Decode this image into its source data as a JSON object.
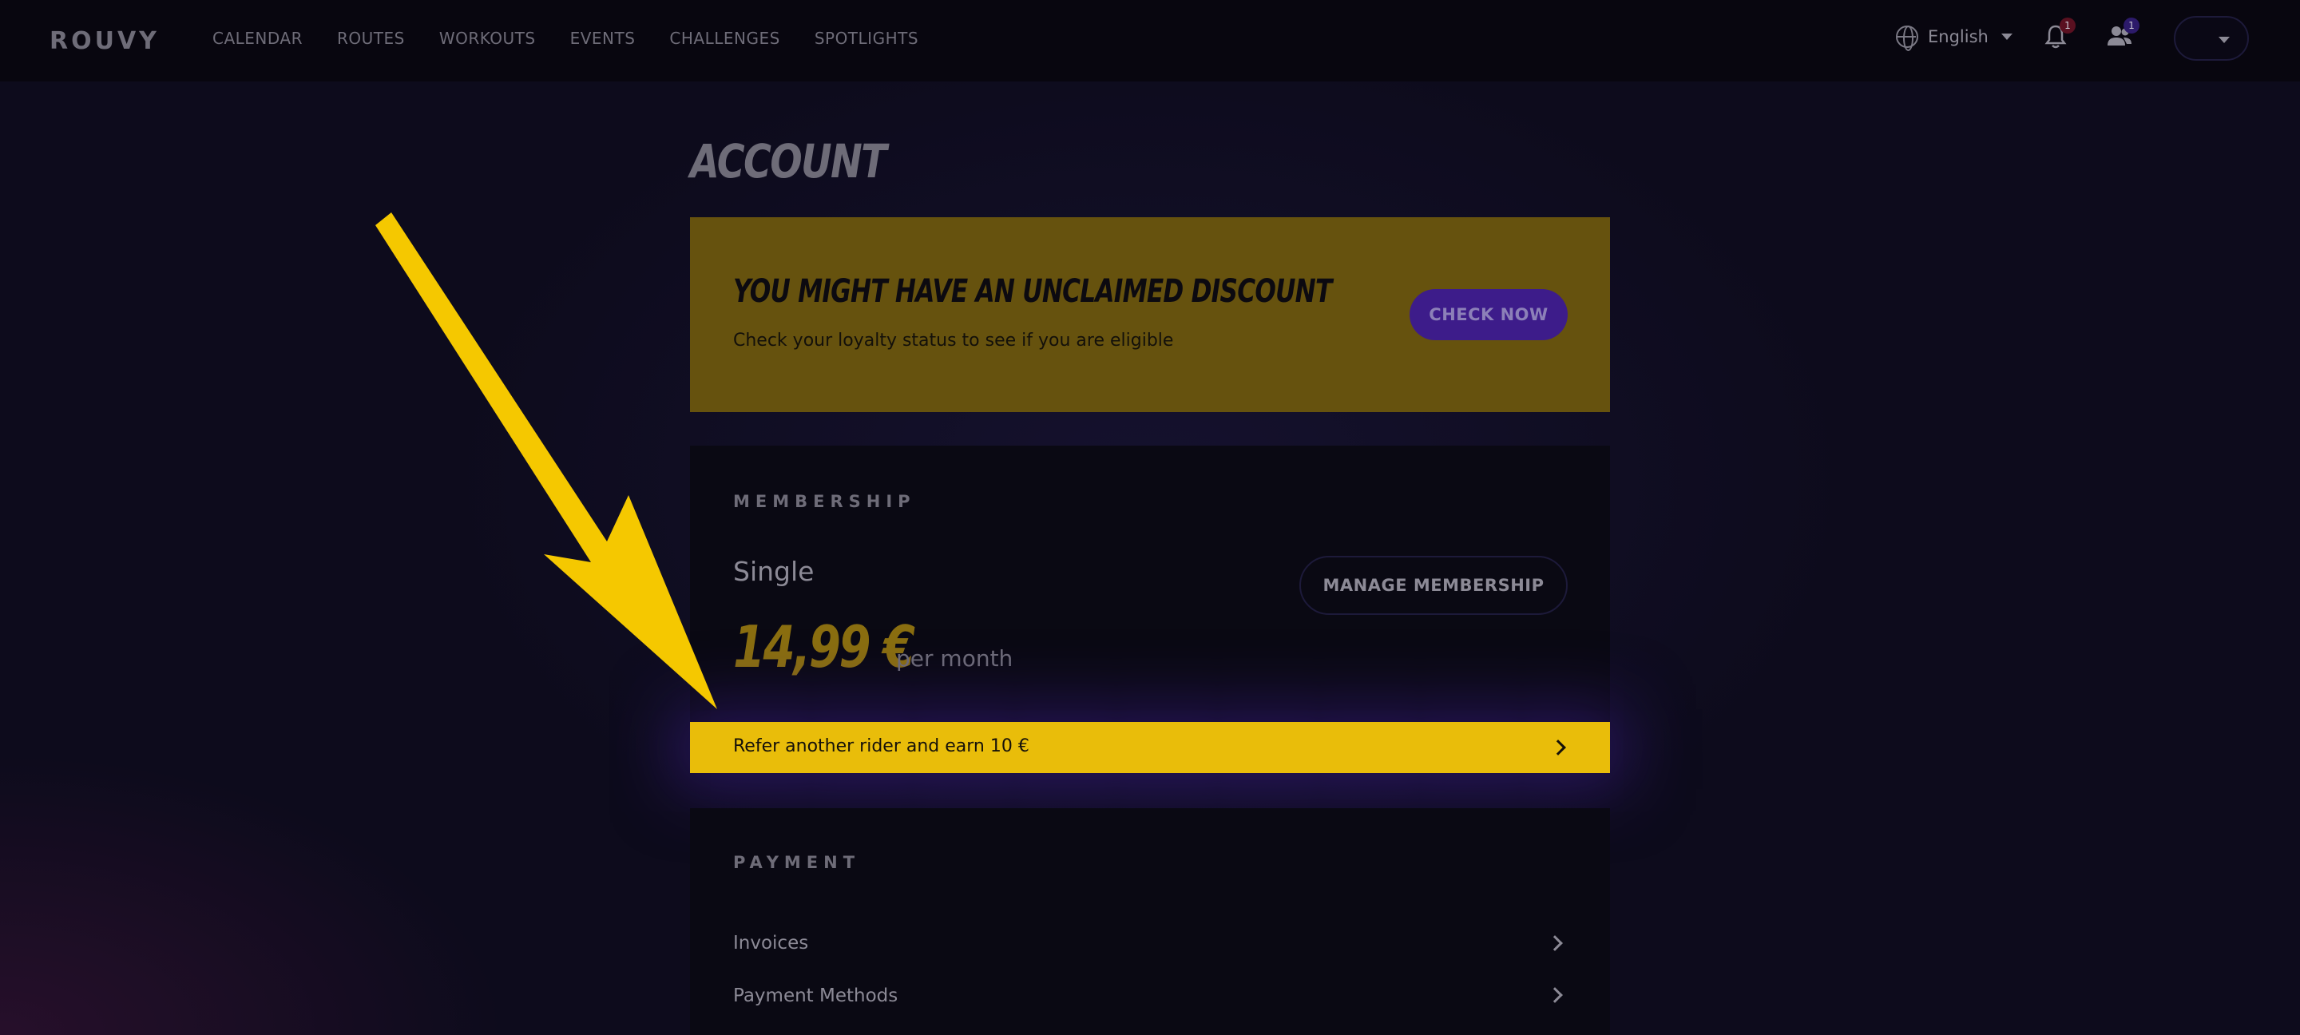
{
  "nav": {
    "logo": "ROUVY",
    "links": [
      "CALENDAR",
      "ROUTES",
      "WORKOUTS",
      "EVENTS",
      "CHALLENGES",
      "SPOTLIGHTS"
    ],
    "language": "English",
    "notifications_count": "1",
    "friends_count": "1"
  },
  "page": {
    "title": "ACCOUNT"
  },
  "discount": {
    "title": "YOU MIGHT HAVE AN UNCLAIMED DISCOUNT",
    "subtitle": "Check your loyalty status to see if you are eligible",
    "button": "CHECK NOW"
  },
  "membership": {
    "section_label": "MEMBERSHIP",
    "plan": "Single",
    "price": "14,99 €",
    "period": "per month",
    "manage_button": "MANAGE MEMBERSHIP"
  },
  "referral": {
    "text": "Refer another rider and earn 10 €"
  },
  "payment": {
    "section_label": "PAYMENT",
    "items": [
      "Invoices",
      "Payment Methods"
    ]
  },
  "colors": {
    "background": "#0d0b1c",
    "discount_banner": "#66520e",
    "referral_bar": "#e9bd0a",
    "check_button": "#3d1c8a",
    "annotation_arrow": "#f5c800"
  }
}
